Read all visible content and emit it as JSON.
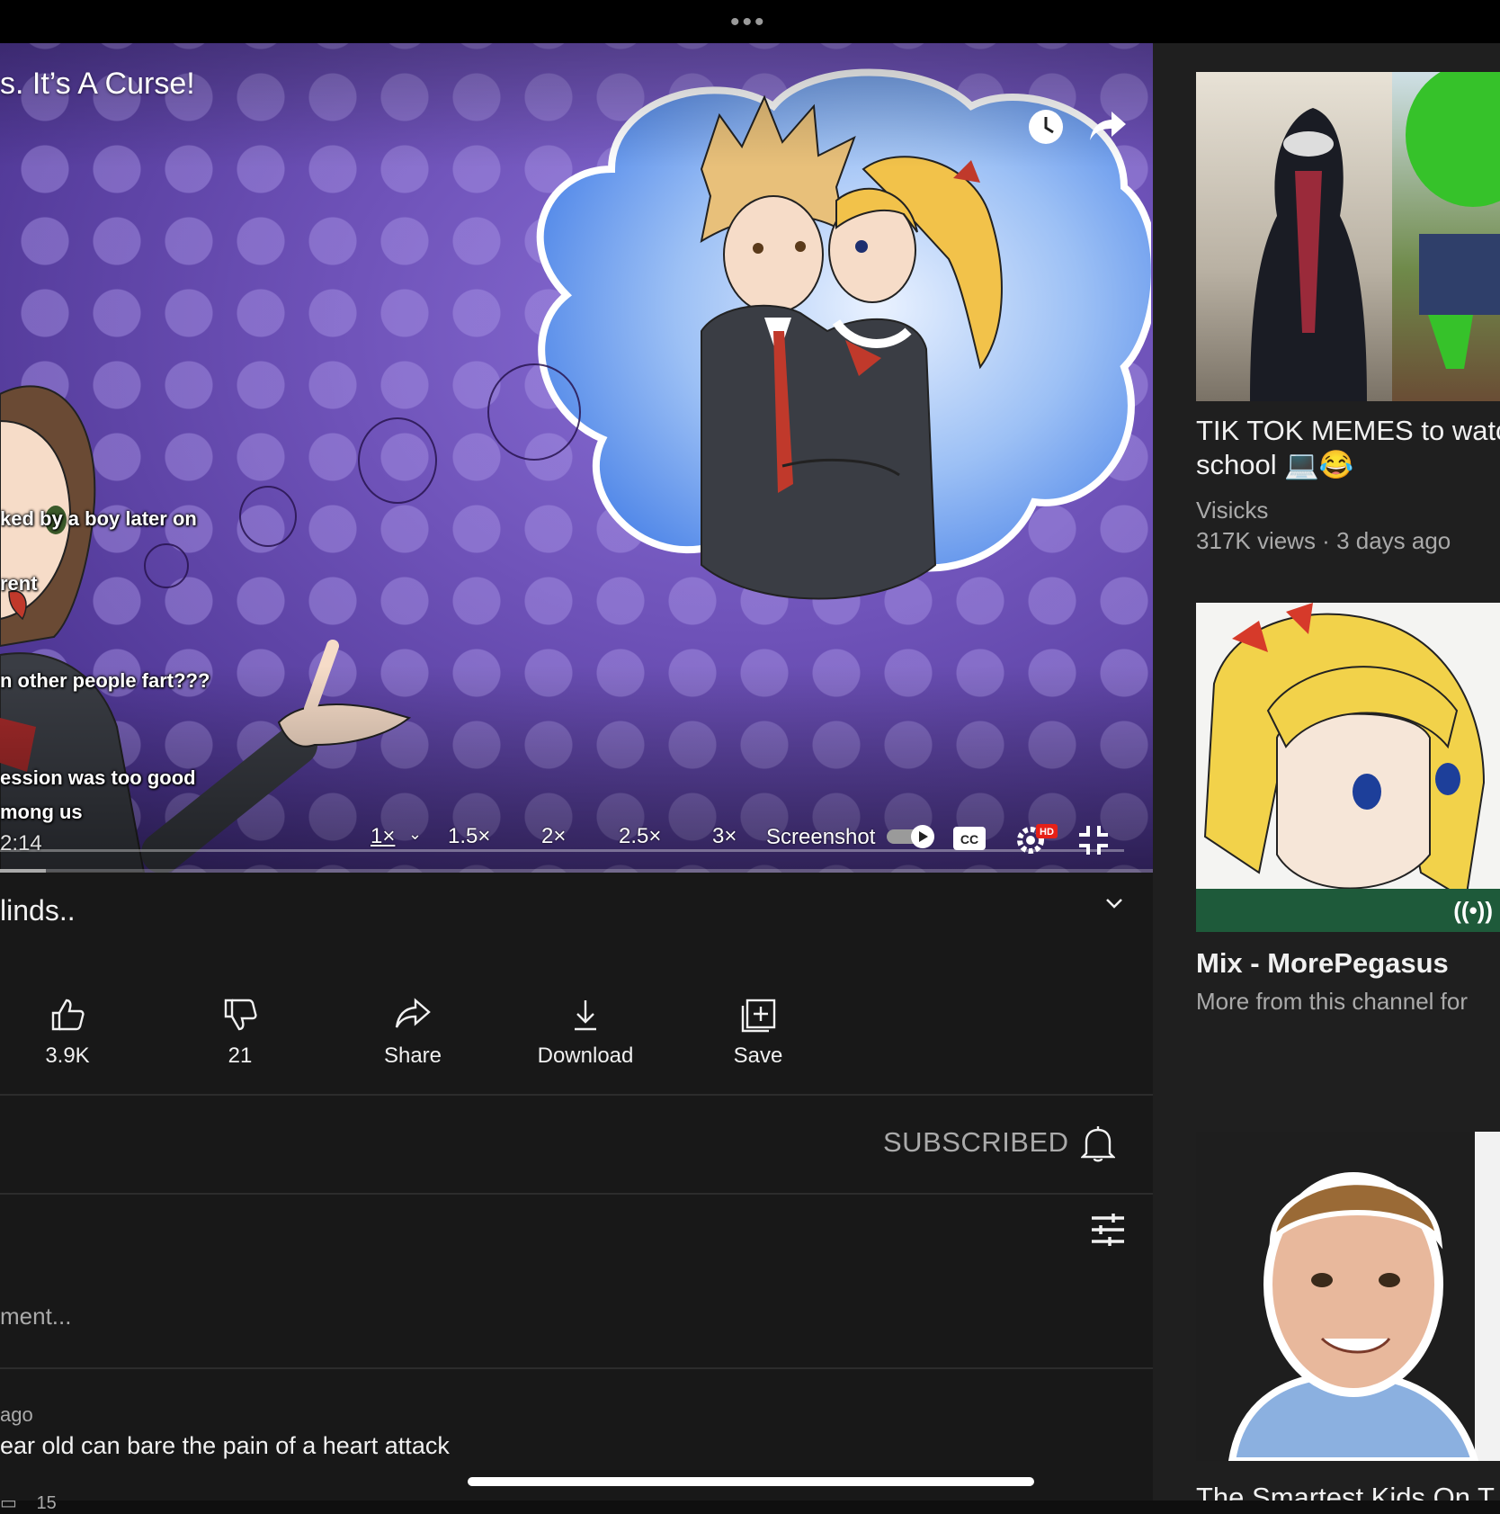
{
  "player": {
    "title": "s. It’s A Curse!",
    "captions": [
      "ked by a boy later on",
      "rent",
      "n other people fart???",
      "ession was too good",
      "mong us"
    ],
    "timecode": "2:14",
    "progress": 0.04,
    "speed": {
      "current": "1×",
      "options": [
        "1.5×",
        "2×",
        "2.5×",
        "3×"
      ]
    },
    "screenshot_label": "Screenshot",
    "cc_label": "CC",
    "hd_badge": "HD"
  },
  "meta": {
    "title": "linds.."
  },
  "actions": {
    "like": "3.9K",
    "dislike": "21",
    "share": "Share",
    "download": "Download",
    "save": "Save"
  },
  "channel": {
    "subscribed_label": "SUBSCRIBED"
  },
  "comments": {
    "placeholder": "ment...",
    "first": {
      "meta": "ago",
      "text": "ear old can bare the pain of a heart attack",
      "likes": "15"
    }
  },
  "sidebar": {
    "items": [
      {
        "title_line1": "TIK TOK MEMES to watc",
        "title_line2": "school 💻😂",
        "channel": "Visicks",
        "stats": "317K views · 3 days ago"
      },
      {
        "title": "Mix - MorePegasus",
        "subtitle": "More from this channel for"
      },
      {
        "title": "The Smartest Kids On T"
      }
    ]
  },
  "colors": {
    "accent": "#ff0000",
    "background": "#181818",
    "sidebar": "#1f1f1f"
  },
  "icons": [
    "clock-icon",
    "share-arrow-icon",
    "cc-icon",
    "settings-icon",
    "exit-fullscreen-icon",
    "chevron-down-icon",
    "thumbs-up-icon",
    "thumbs-down-icon",
    "share-icon",
    "download-icon",
    "save-icon",
    "bell-icon",
    "filter-icon",
    "live-icon"
  ]
}
